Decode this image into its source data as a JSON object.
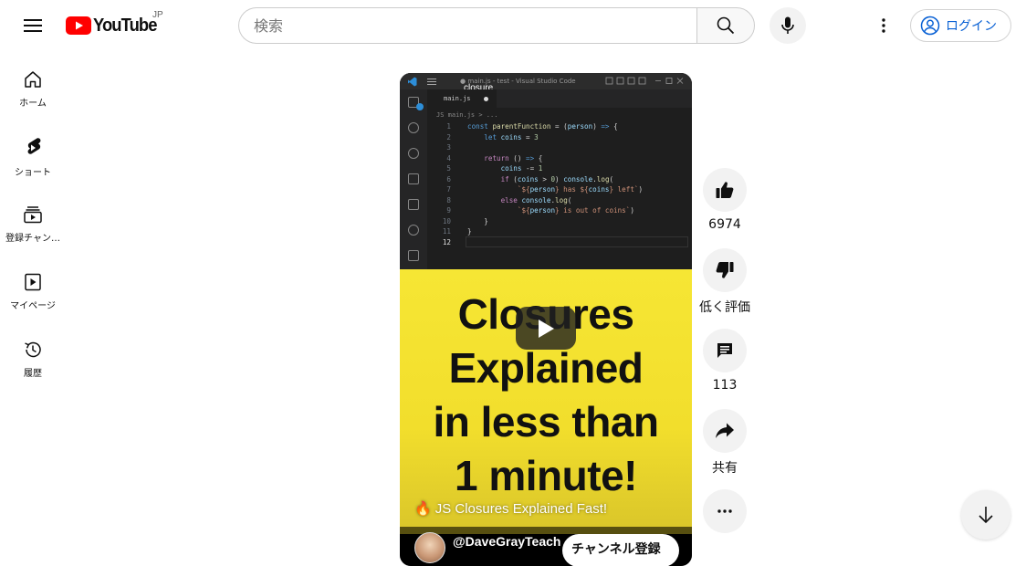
{
  "header": {
    "logo_text": "YouTube",
    "region": "JP",
    "search_placeholder": "検索",
    "login_label": "ログイン"
  },
  "guide": {
    "items": [
      {
        "label": "ホーム",
        "icon": "home-icon"
      },
      {
        "label": "ショート",
        "icon": "shorts-icon"
      },
      {
        "label": "登録チャン…",
        "icon": "subscriptions-icon"
      },
      {
        "label": "マイページ",
        "icon": "you-icon"
      },
      {
        "label": "履歴",
        "icon": "history-icon"
      }
    ]
  },
  "video": {
    "editor_window_title": "● main.js - test - Visual Studio Code",
    "overlay_title": "closure",
    "tab_label": "main.js",
    "breadcrumb": "JS main.js > ...",
    "code_lines": [
      {
        "n": "1",
        "html": "<span class=\"kw\">const</span> <span class=\"fn\">parentFunction</span> = (<span class=\"var\">person</span>) <span class=\"kw\">=></span> {"
      },
      {
        "n": "2",
        "html": "    <span class=\"kw\">let</span> <span class=\"var\">coins</span> = <span class=\"num\">3</span>"
      },
      {
        "n": "3",
        "html": ""
      },
      {
        "n": "4",
        "html": "    <span class=\"kw2\">return</span> () <span class=\"kw\">=></span> {"
      },
      {
        "n": "5",
        "html": "        <span class=\"var\">coins</span> -= <span class=\"num\">1</span>"
      },
      {
        "n": "6",
        "html": "        <span class=\"kw2\">if</span> (<span class=\"var\">coins</span> > <span class=\"num\">0</span>) <span class=\"var\">console</span>.<span class=\"fn\">log</span>("
      },
      {
        "n": "7",
        "html": "            <span class=\"str\">`${<span class=\"var\">person</span>} has ${<span class=\"var\">coins</span>} left`</span>)"
      },
      {
        "n": "8",
        "html": "        <span class=\"kw2\">else</span> <span class=\"var\">console</span>.<span class=\"fn\">log</span>("
      },
      {
        "n": "9",
        "html": "            <span class=\"str\">`${<span class=\"var\">person</span>} is out of coins`</span>)"
      },
      {
        "n": "10",
        "html": "    }"
      },
      {
        "n": "11",
        "html": "}"
      },
      {
        "n": "12",
        "html": ""
      }
    ],
    "headline_lines": [
      "Closures",
      "Explained",
      "in less than",
      "1 minute!"
    ],
    "title_emoji": "🔥",
    "title": "JS Closures Explained Fast!",
    "channel_name": "@DaveGrayTeach",
    "subscribe_label": "チャンネル登録"
  },
  "actions": {
    "like_count": "6974",
    "dislike_label": "低く評価",
    "comment_count": "113",
    "share_label": "共有"
  },
  "colors": {
    "brand_red": "#ff0000",
    "thumbnail_yellow": "#f3e230",
    "link_blue": "#065fd4"
  }
}
